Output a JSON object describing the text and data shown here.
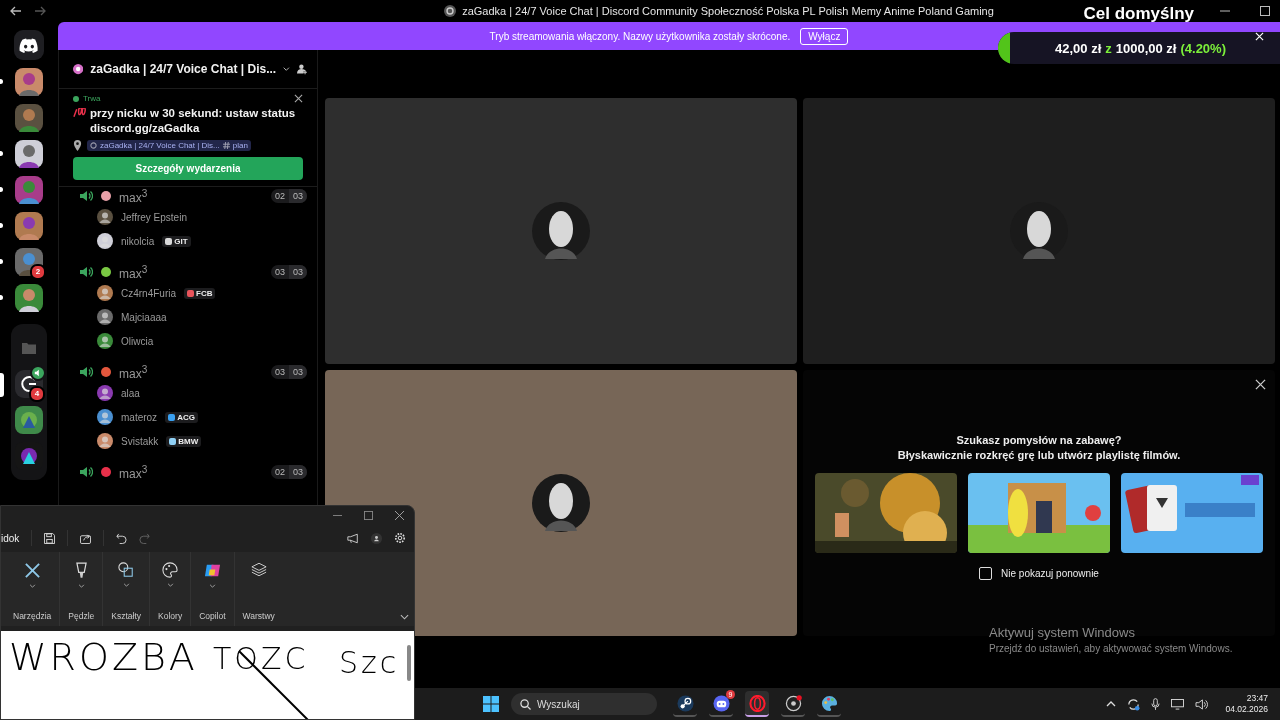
{
  "titlebar": {
    "title": "zaGadka | 24/7 Voice Chat | Discord Community Społeczność Polska PL Polish Memy Anime Poland Gaming"
  },
  "goal_overlay": {
    "title": "Cel domyślny",
    "amount": "42,00 zł",
    "separator": "z",
    "target": "1000,00 zł",
    "percent": "(4.20%)",
    "level": 0.042
  },
  "servers": [
    {
      "kind": "home",
      "unread": false,
      "selected": false
    },
    {
      "kind": "picture",
      "unread": true,
      "selected": false
    },
    {
      "kind": "picture",
      "unread": false,
      "selected": false
    },
    {
      "kind": "picture",
      "unread": true,
      "selected": false
    },
    {
      "kind": "picture",
      "unread": true,
      "selected": false
    },
    {
      "kind": "picture",
      "unread": true,
      "selected": false
    },
    {
      "kind": "picture",
      "unread": true,
      "selected": false,
      "badge": "2"
    },
    {
      "kind": "picture",
      "unread": true,
      "selected": false
    }
  ],
  "folder": [
    {
      "kind": "folder",
      "unread": false,
      "selected": false
    },
    {
      "kind": "logo",
      "unread": false,
      "selected": true,
      "badge": "4"
    },
    {
      "kind": "picture",
      "unread": false,
      "selected": false
    },
    {
      "kind": "picture",
      "unread": false,
      "selected": false
    }
  ],
  "banner": {
    "text": "Tryb streamowania włączony. Nazwy użytkownika zostały skrócone.",
    "button": "Wyłącz"
  },
  "server_header": {
    "name": "zaGadka | 24/7 Voice Chat | Dis..."
  },
  "event": {
    "status": "Trwa",
    "title": "przy nicku w 30 sekund: ustaw status discord.gg/zaGadka",
    "location": "zaGadka | 24/7 Voice Chat | Dis...",
    "channel": "plan",
    "button": "Szczegóły wydarzenia"
  },
  "channels": [
    {
      "name": "max$^{3}$",
      "color": "#e8a0a8",
      "count": "02",
      "limit": "03",
      "members": [
        {
          "name": "Jeffrey Epstein"
        },
        {
          "name": "nikolcia",
          "tag": {
            "label": "GIT",
            "color": "#d9d9d9"
          }
        }
      ]
    },
    {
      "name": "max$^{3}$",
      "color": "#7ac943",
      "count": "03",
      "limit": "03",
      "members": [
        {
          "name": "Cz4rn4Furia",
          "tag": {
            "label": "FCB",
            "color": "#e8545b"
          }
        },
        {
          "name": "Majciaaaa"
        },
        {
          "name": "Oliwcia"
        }
      ]
    },
    {
      "name": "max$^{3}$",
      "color": "#e4573d",
      "count": "03",
      "limit": "03",
      "members": [
        {
          "name": "alaa"
        },
        {
          "name": "materoz",
          "tag": {
            "label": "ACG",
            "color": "#3aa0f0"
          }
        },
        {
          "name": "Svistakk",
          "tag": {
            "label": "BMW",
            "color": "#8fd0f5"
          }
        }
      ]
    },
    {
      "name": "max$^{3}$",
      "color": "#e8304a",
      "count": "02",
      "limit": "03"
    }
  ],
  "tiles": [
    {
      "color": "#2e2e2e"
    },
    {
      "color": "#1e1e1e"
    },
    {
      "color": "#776657"
    }
  ],
  "activity": {
    "title": "Szukasz pomysłów na zabawę?",
    "subtitle": "Błyskawicznie rozkręć grę lub utwórz playlistę filmów.",
    "games": [
      {
        "kind": "picture"
      },
      {
        "kind": "picture"
      },
      {
        "kind": "picture"
      }
    ],
    "checkbox": {
      "label": "Nie pokazuj ponownie",
      "checked": false
    }
  },
  "activation": {
    "title": "Aktywuj system Windows",
    "text": "Przejdź do ustawień, aby aktywować system Windows."
  },
  "paint": {
    "menu": "idok",
    "groups": [
      {
        "kind": "tools",
        "label": "Narzędzia"
      },
      {
        "kind": "brushes",
        "label": "Pędzle"
      },
      {
        "kind": "shapes",
        "label": "Kształty"
      },
      {
        "kind": "colors",
        "label": "Kolory"
      },
      {
        "kind": "copilot",
        "label": "Copilot"
      },
      {
        "kind": "layers",
        "label": "Warstwy"
      }
    ],
    "handwriting": [
      "WROZBA",
      "TOZC",
      "Szc"
    ]
  },
  "taskbar": {
    "search": {
      "placeholder": "Wyszukaj"
    },
    "apps": [
      {
        "kind": "steam",
        "selected": false
      },
      {
        "kind": "chat",
        "selected": false,
        "badge": "9"
      },
      {
        "kind": "browser",
        "selected": true
      },
      {
        "kind": "capture",
        "selected": false
      },
      {
        "kind": "paint",
        "selected": false
      }
    ],
    "time": "23:47",
    "date": "04.02.2026"
  }
}
